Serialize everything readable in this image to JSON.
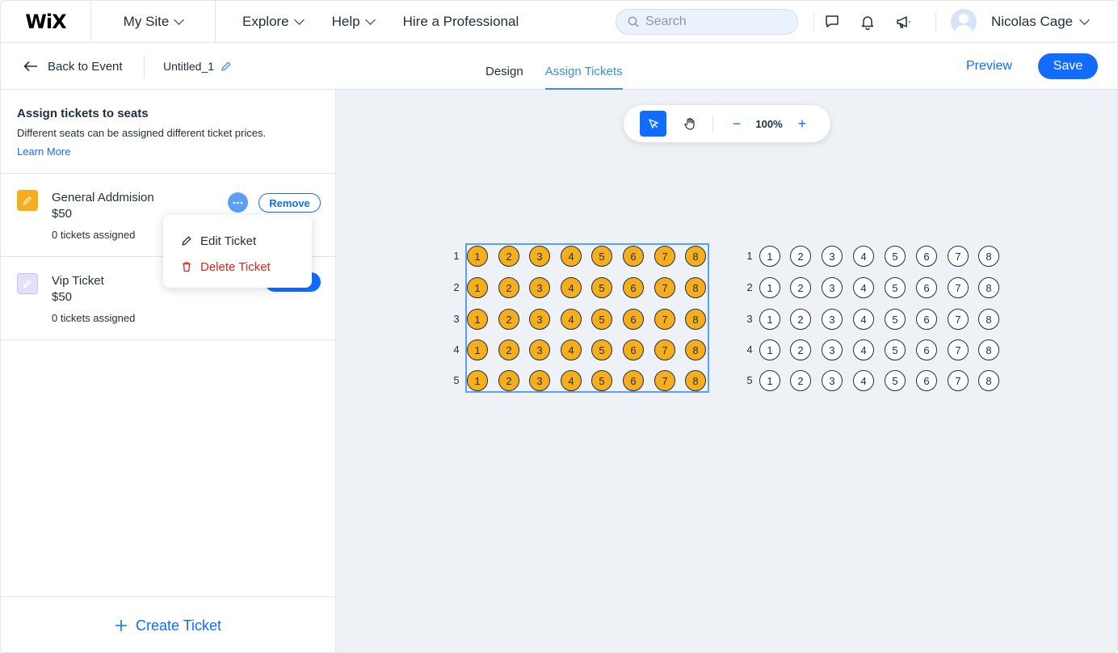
{
  "topbar": {
    "logo": "WiX",
    "site_menu": "My Site",
    "nav": [
      "Explore",
      "Help",
      "Hire a Professional"
    ],
    "search_placeholder": "Search",
    "icons": [
      "chat-icon",
      "bell-icon",
      "megaphone-icon"
    ],
    "user_name": "Nicolas Cage"
  },
  "subbar": {
    "back_label": "Back to Event",
    "doc_title": "Untitled_1",
    "tabs": [
      {
        "label": "Design",
        "active": false
      },
      {
        "label": "Assign Tickets",
        "active": true
      }
    ],
    "preview_label": "Preview",
    "save_label": "Save"
  },
  "sidebar": {
    "title": "Assign tickets to seats",
    "description": "Different seats can be assigned different ticket prices.",
    "learn_more": "Learn More",
    "tickets": [
      {
        "name": "General Addmision",
        "price": "$50",
        "count": "0 tickets assigned",
        "color": "#f6ae1c",
        "remove_label": "Remove"
      },
      {
        "name": "Vip Ticket",
        "price": "$50",
        "count": "0 tickets assigned",
        "color": "#e4e0fb"
      }
    ],
    "create_label": "Create Ticket"
  },
  "context_menu": {
    "edit_label": "Edit Ticket",
    "delete_label": "Delete Ticket"
  },
  "canvas_toolbar": {
    "zoom": "100%",
    "minus": "−",
    "plus": "+"
  },
  "seating": {
    "rows": [
      "1",
      "2",
      "3",
      "4",
      "5"
    ],
    "seats": [
      "1",
      "2",
      "3",
      "4",
      "5",
      "6",
      "7",
      "8"
    ],
    "sections": [
      {
        "name": "left",
        "assigned": true,
        "assigned_color": "#f6ae1c"
      },
      {
        "name": "right",
        "assigned": false
      }
    ]
  },
  "colors": {
    "accent": "#116dff",
    "delete": "#e62214",
    "assigned_seat": "#f6ae1c"
  }
}
